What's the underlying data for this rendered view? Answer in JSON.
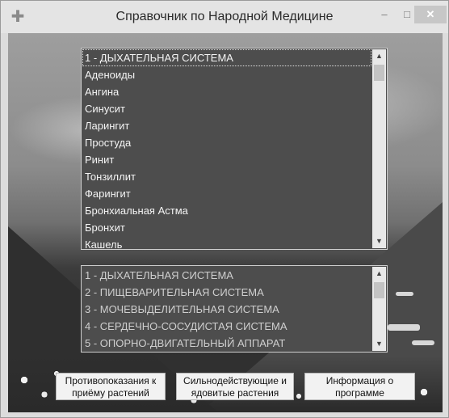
{
  "window": {
    "title": "Справочник по Народной Медицине",
    "controls": {
      "minimize": "–",
      "maximize": "□",
      "close": "✕"
    },
    "icon": "cross-icon"
  },
  "diseases_list": {
    "items": [
      "1 - ДЫХАТЕЛЬНАЯ СИСТЕМА",
      "Аденоиды",
      "Ангина",
      "Синусит",
      "Ларингит",
      "Простуда",
      "Ринит",
      "Тонзиллит",
      "Фарингит",
      "Бронхиальная Астма",
      "Бронхит",
      "Кашель"
    ],
    "selected_index": 0
  },
  "systems_list": {
    "items": [
      "1 - ДЫХАТЕЛЬНАЯ СИСТЕМА",
      "2 - ПИЩЕВАРИТЕЛЬНАЯ СИСТЕМА",
      "3 - МОЧЕВЫДЕЛИТЕЛЬНАЯ СИСТЕМА",
      "4 - СЕРДЕЧНО-СОСУДИСТАЯ СИСТЕМА",
      "5 - ОПОРНО-ДВИГАТЕЛЬНЫЙ АППАРАТ"
    ]
  },
  "buttons": {
    "contraindications": {
      "line1": "Противопоказания к",
      "line2": "приёму растений"
    },
    "potent_plants": {
      "line1": "Сильнодействующие и",
      "line2": "ядовитые растения"
    },
    "about": {
      "line1": "Информация о",
      "line2": "программе"
    }
  },
  "scroll_glyphs": {
    "up": "▲",
    "down": "▼"
  }
}
